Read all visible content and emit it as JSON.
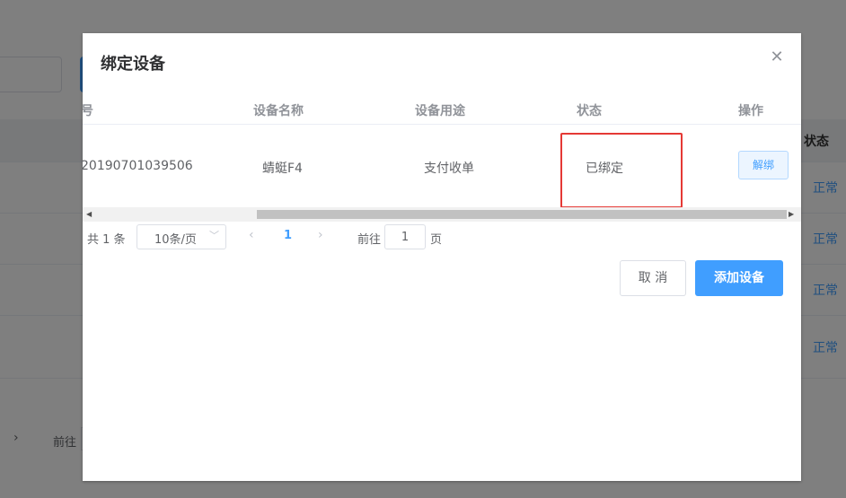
{
  "background": {
    "status_header": "状态",
    "rows": [
      {
        "status": "正常"
      },
      {
        "status": "正常"
      },
      {
        "status": "正常"
      },
      {
        "status": "正常"
      }
    ],
    "pager": {
      "goto_label": "前往"
    }
  },
  "dialog": {
    "title": "绑定设备",
    "close_icon": "close-icon",
    "table": {
      "columns": [
        "号",
        "设备名称",
        "设备用途",
        "状态",
        "操作"
      ],
      "rows": [
        {
          "id": "20190701039506",
          "name": "蜻蜓F4",
          "purpose": "支付收单",
          "status": "已绑定",
          "action": "解绑"
        }
      ]
    },
    "pager": {
      "total": "共 1 条",
      "page_size": "10条/页",
      "current_page": "1",
      "goto_label": "前往",
      "goto_value": "1",
      "page_label": "页"
    },
    "buttons": {
      "cancel": "取 消",
      "add": "添加设备"
    }
  },
  "colors": {
    "primary": "#409eff",
    "highlight": "#e53935"
  }
}
